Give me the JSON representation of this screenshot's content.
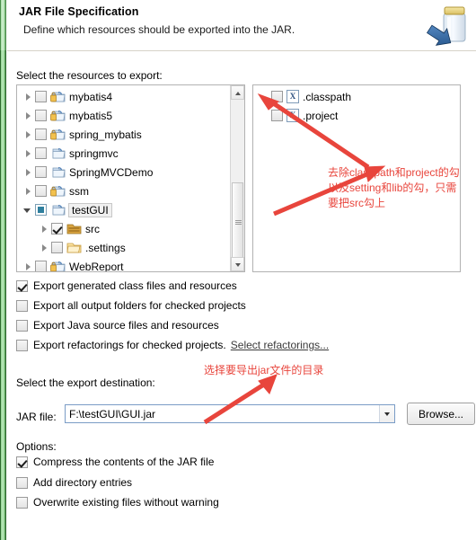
{
  "header": {
    "title": "JAR File Specification",
    "subtitle": "Define which resources should be exported into the JAR.",
    "icon": "jar-export-icon"
  },
  "resources": {
    "label": "Select the resources to export:",
    "left_tree": [
      {
        "name": "mybatis4",
        "twisty": "closed",
        "check": "empty",
        "icon": "java-project-folder-icon",
        "indent": 0,
        "selected": false
      },
      {
        "name": "mybatis5",
        "twisty": "closed",
        "check": "empty",
        "icon": "java-project-folder-icon",
        "indent": 0,
        "selected": false
      },
      {
        "name": "spring_mybatis",
        "twisty": "closed",
        "check": "empty",
        "icon": "java-project-folder-icon",
        "indent": 0,
        "selected": false
      },
      {
        "name": "springmvc",
        "twisty": "closed",
        "check": "empty",
        "icon": "project-folder-icon",
        "indent": 0,
        "selected": false
      },
      {
        "name": "SpringMVCDemo",
        "twisty": "closed",
        "check": "empty",
        "icon": "project-folder-icon",
        "indent": 0,
        "selected": false
      },
      {
        "name": "ssm",
        "twisty": "closed",
        "check": "empty",
        "icon": "java-project-folder-icon",
        "indent": 0,
        "selected": false
      },
      {
        "name": "testGUI",
        "twisty": "open",
        "check": "grayed",
        "icon": "project-folder-icon",
        "indent": 0,
        "selected": true
      },
      {
        "name": "src",
        "twisty": "closed",
        "check": "checked",
        "icon": "source-folder-icon",
        "indent": 1,
        "selected": false
      },
      {
        "name": ".settings",
        "twisty": "closed",
        "check": "empty",
        "icon": "folder-icon",
        "indent": 1,
        "selected": false
      },
      {
        "name": "WebReport",
        "twisty": "closed",
        "check": "empty",
        "icon": "java-project-folder-icon",
        "indent": 0,
        "selected": false
      }
    ],
    "right_tree": [
      {
        "name": ".classpath",
        "check": "empty",
        "icon": "xml-file-icon",
        "badge": "X"
      },
      {
        "name": ".project",
        "check": "empty",
        "icon": "xml-file-icon",
        "badge": "X"
      }
    ]
  },
  "export_options": [
    {
      "label": "Export generated class files and resources",
      "checked": true
    },
    {
      "label": "Export all output folders for checked projects",
      "checked": false
    },
    {
      "label": "Export Java source files and resources",
      "checked": false
    },
    {
      "label": "Export refactorings for checked projects.",
      "checked": false,
      "link": "Select refactorings..."
    }
  ],
  "destination": {
    "label": "Select the export destination:",
    "jar_file_label": "JAR file:",
    "jar_file_value": "F:\\testGUI\\GUI.jar",
    "browse_button": "Browse..."
  },
  "options": {
    "label": "Options:",
    "items": [
      {
        "label": "Compress the contents of the JAR file",
        "checked": true
      },
      {
        "label": "Add directory entries",
        "checked": false
      },
      {
        "label": "Overwrite existing files without warning",
        "checked": false
      }
    ]
  },
  "annotations": {
    "color": "#e8453c",
    "note1_line1": "去除classpath和project的勾",
    "note1_line2": "以及setting和lib的勾，只需",
    "note1_line3": "要把src勾上",
    "note2": "选择要导出jar文件的目录"
  }
}
